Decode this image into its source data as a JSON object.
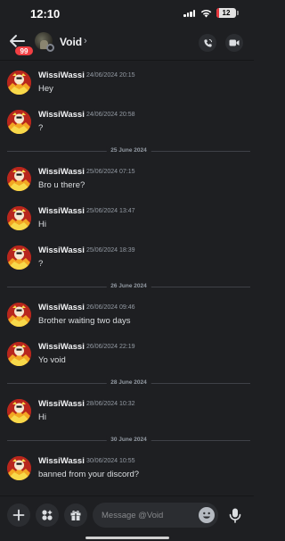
{
  "status_bar": {
    "time": "12:10",
    "battery": "12",
    "battery_level": 0.12
  },
  "header": {
    "back_icon": "arrow-left-icon",
    "unread_badge": "99",
    "channel_name": "Void",
    "chevron": "›",
    "call_icon": "phone-icon",
    "video_icon": "video-camera-icon"
  },
  "messages": [
    {
      "type": "message",
      "author": "WissiWassi",
      "timestamp": "24/06/2024 20:15",
      "text": "Hey"
    },
    {
      "type": "message",
      "author": "WissiWassi",
      "timestamp": "24/06/2024 20:58",
      "text": "?"
    },
    {
      "type": "divider",
      "label": "25 June 2024"
    },
    {
      "type": "message",
      "author": "WissiWassi",
      "timestamp": "25/06/2024 07:15",
      "text": "Bro u there?"
    },
    {
      "type": "message",
      "author": "WissiWassi",
      "timestamp": "25/06/2024 13:47",
      "text": "Hi"
    },
    {
      "type": "message",
      "author": "WissiWassi",
      "timestamp": "25/06/2024 18:39",
      "text": "?"
    },
    {
      "type": "divider",
      "label": "26 June 2024"
    },
    {
      "type": "message",
      "author": "WissiWassi",
      "timestamp": "26/06/2024 09:46",
      "text": "Brother waiting two days"
    },
    {
      "type": "message",
      "author": "WissiWassi",
      "timestamp": "26/06/2024 22:19",
      "text": "Yo void"
    },
    {
      "type": "divider",
      "label": "28 June 2024"
    },
    {
      "type": "message",
      "author": "WissiWassi",
      "timestamp": "28/06/2024 10:32",
      "text": "Hi"
    },
    {
      "type": "divider",
      "label": "30 June 2024"
    },
    {
      "type": "message",
      "author": "WissiWassi",
      "timestamp": "30/06/2024 10:55",
      "text": "banned from your discord?"
    }
  ],
  "composer": {
    "placeholder": "Message @Void",
    "add_icon": "plus-icon",
    "apps_icon": "apps-icon",
    "gift_icon": "gift-icon",
    "emoji_icon": "emoji-icon",
    "mic_icon": "microphone-icon"
  },
  "colors": {
    "background": "#1e1f22",
    "surface": "#2b2d31",
    "badge": "#f23f43",
    "text": "#dbdee1",
    "muted": "#949ba4"
  }
}
